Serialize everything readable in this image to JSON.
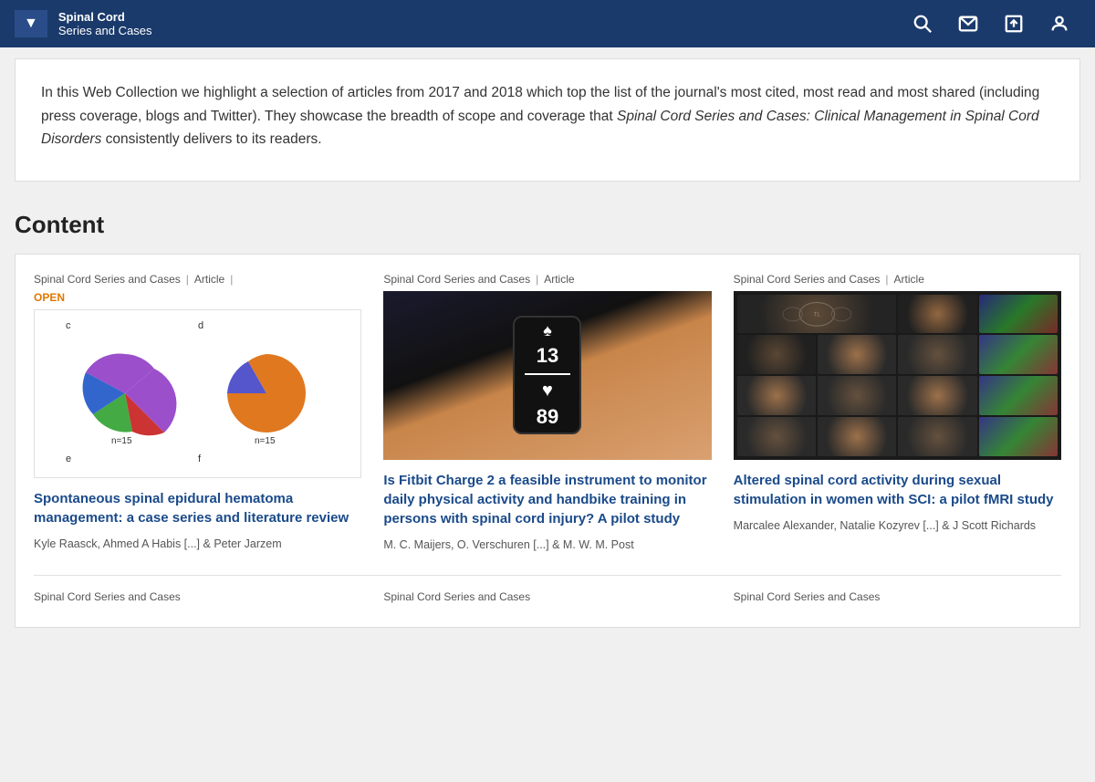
{
  "header": {
    "dropdown_label": "▼",
    "title_main": "Spinal Cord",
    "title_sub": "Series and Cases",
    "icons": {
      "search": "🔍",
      "mail": "✉",
      "upload": "⬆",
      "user": "👤"
    }
  },
  "intro": {
    "text_1": "In this Web Collection we highlight a selection of articles from 2017 and 2018 which top the list of the journal's most cited, most read and most shared (including press coverage, blogs and Twitter). They showcase the breadth of scope and coverage that ",
    "italic": "Spinal Cord Series and Cases: Clinical Management in Spinal Cord Disorders",
    "text_2": " consistently delivers to its readers."
  },
  "content": {
    "heading": "Content",
    "articles": [
      {
        "journal": "Spinal Cord Series and Cases",
        "type": "Article",
        "open": true,
        "open_label": "OPEN",
        "title": "Spontaneous spinal epidural hematoma management: a case series and literature review",
        "authors": "Kyle Raasck, Ahmed A Habis [...] & Peter Jarzem",
        "has_pie": true
      },
      {
        "journal": "Spinal Cord Series and Cases",
        "type": "Article",
        "open": false,
        "title": "Is Fitbit Charge 2 a feasible instrument to monitor daily physical activity and handbike training in persons with spinal cord injury? A pilot study",
        "authors": "M. C. Maijers, O. Verschuren [...] & M. W. M. Post",
        "has_fitbit": true
      },
      {
        "journal": "Spinal Cord Series and Cases",
        "type": "Article",
        "open": false,
        "title": "Altered spinal cord activity during sexual stimulation in women with SCI: a pilot fMRI study",
        "authors": "Marcalee Alexander, Natalie Kozyrev [...] & J Scott Richards",
        "has_mri": true
      }
    ],
    "bottom_articles_label": "Spinal Cord Series and Cases"
  },
  "pie_chart": {
    "label_c": "c",
    "label_d": "d",
    "label_n15_left": "n=15",
    "label_n15_right": "n=15",
    "label_e": "e",
    "label_f": "f"
  }
}
